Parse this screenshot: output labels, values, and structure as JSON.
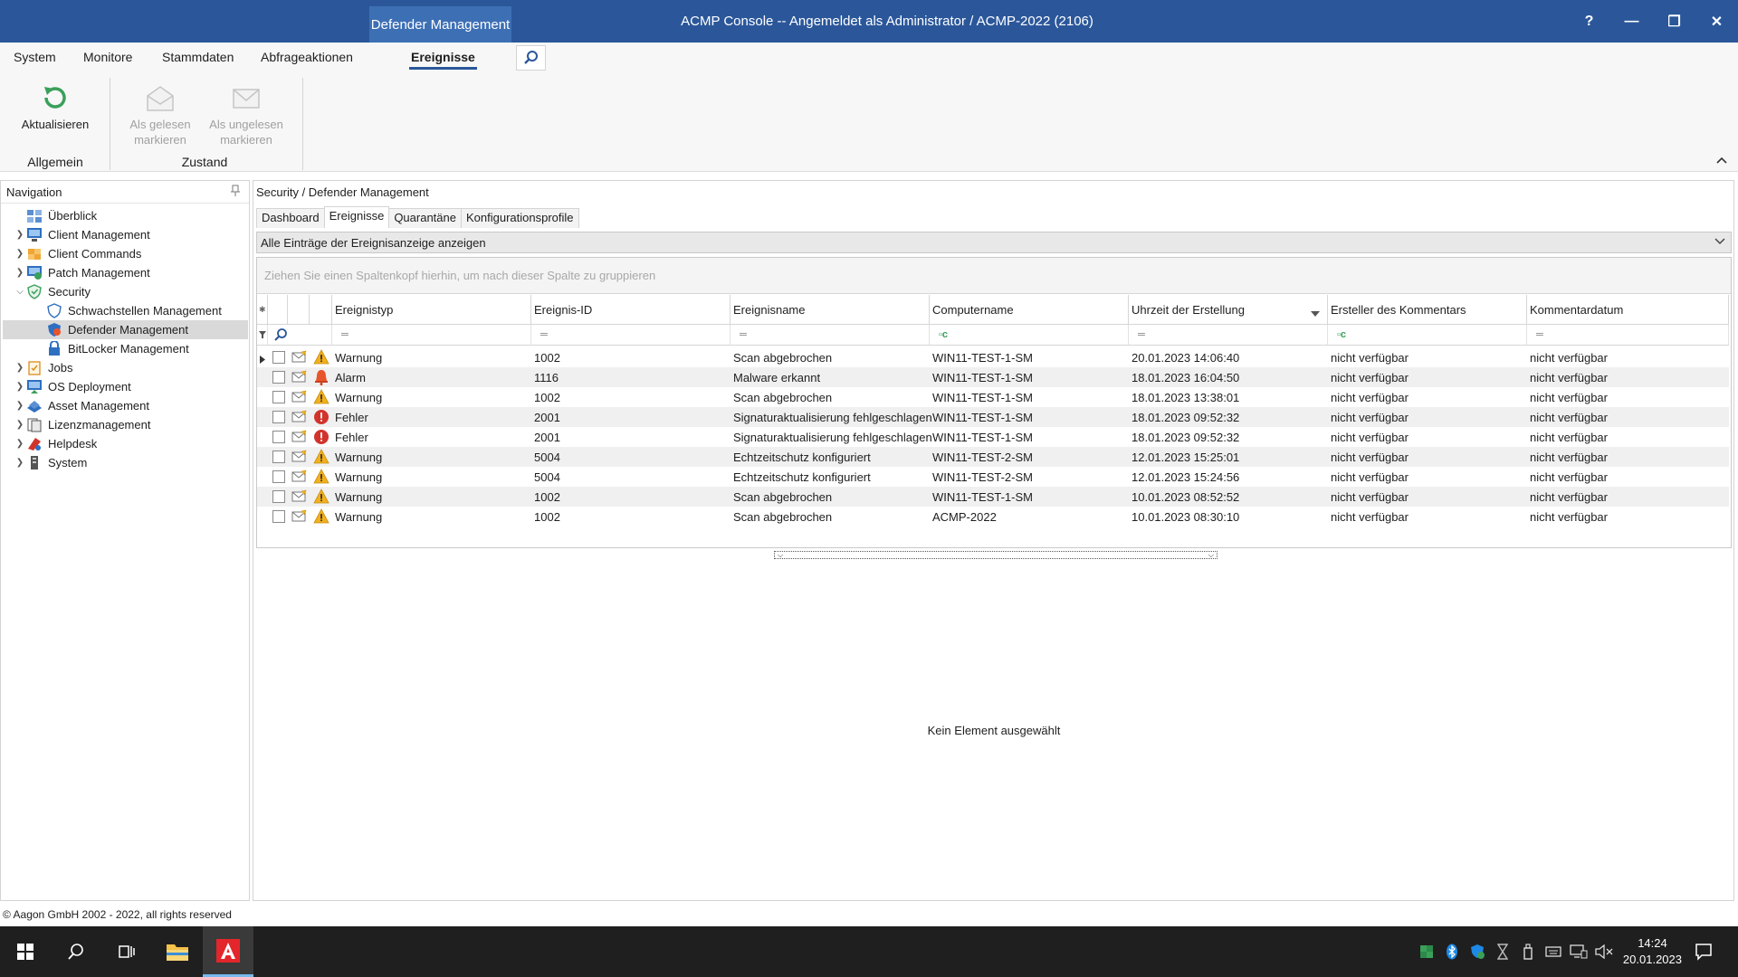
{
  "window": {
    "context_tab": "Defender Management",
    "title": "ACMP Console -- Angemeldet als Administrator / ACMP-2022 (2106)",
    "help": "?",
    "minimize": "—",
    "restore": "❐",
    "close": "✕"
  },
  "ribbon": {
    "tabs": [
      "System",
      "Monitore",
      "Stammdaten",
      "Abfrageaktionen",
      "Ereignisse"
    ],
    "active_tab": "Ereignisse",
    "buttons": {
      "refresh": "Aktualisieren",
      "mark_read_1": "Als gelesen",
      "mark_read_2": "markieren",
      "mark_unread_1": "Als ungelesen",
      "mark_unread_2": "markieren"
    },
    "groups": {
      "general": "Allgemein",
      "state": "Zustand"
    }
  },
  "navigation": {
    "title": "Navigation",
    "items": [
      {
        "label": "Überblick"
      },
      {
        "label": "Client Management"
      },
      {
        "label": "Client Commands"
      },
      {
        "label": "Patch Management"
      },
      {
        "label": "Security"
      },
      {
        "label": "Schwachstellen Management"
      },
      {
        "label": "Defender Management"
      },
      {
        "label": "BitLocker Management"
      },
      {
        "label": "Jobs"
      },
      {
        "label": "OS Deployment"
      },
      {
        "label": "Asset Management"
      },
      {
        "label": "Lizenzmanagement"
      },
      {
        "label": "Helpdesk"
      },
      {
        "label": "System"
      }
    ]
  },
  "main": {
    "breadcrumb": "Security / Defender Management",
    "tabs": [
      "Dashboard",
      "Ereignisse",
      "Quarantäne",
      "Konfigurationsprofile"
    ],
    "filter": "Alle Einträge der Ereignisanzeige anzeigen",
    "group_hint": "Ziehen Sie einen Spaltenkopf hierhin, um nach dieser Spalte zu gruppieren",
    "columns": [
      "Ereignistyp",
      "Ereignis-ID",
      "Ereignisname",
      "Computername",
      "Uhrzeit der Erstellung",
      "Ersteller des Kommentars",
      "Kommentardatum"
    ],
    "rows": [
      {
        "type": "Warnung",
        "icon": "warning",
        "id": "1002",
        "name": "Scan abgebrochen",
        "computer": "WIN11-TEST-1-SM",
        "time": "20.01.2023 14:06:40",
        "author": "nicht verfügbar",
        "cdate": "nicht verfügbar"
      },
      {
        "type": "Alarm",
        "icon": "alarm",
        "id": "1116",
        "name": "Malware erkannt",
        "computer": "WIN11-TEST-1-SM",
        "time": "18.01.2023 16:04:50",
        "author": "nicht verfügbar",
        "cdate": "nicht verfügbar"
      },
      {
        "type": "Warnung",
        "icon": "warning",
        "id": "1002",
        "name": "Scan abgebrochen",
        "computer": "WIN11-TEST-1-SM",
        "time": "18.01.2023 13:38:01",
        "author": "nicht verfügbar",
        "cdate": "nicht verfügbar"
      },
      {
        "type": "Fehler",
        "icon": "error",
        "id": "2001",
        "name": "Signaturaktualisierung fehlgeschlagen",
        "computer": "WIN11-TEST-1-SM",
        "time": "18.01.2023 09:52:32",
        "author": "nicht verfügbar",
        "cdate": "nicht verfügbar"
      },
      {
        "type": "Fehler",
        "icon": "error",
        "id": "2001",
        "name": "Signaturaktualisierung fehlgeschlagen",
        "computer": "WIN11-TEST-1-SM",
        "time": "18.01.2023 09:52:32",
        "author": "nicht verfügbar",
        "cdate": "nicht verfügbar"
      },
      {
        "type": "Warnung",
        "icon": "warning",
        "id": "5004",
        "name": "Echtzeitschutz konfiguriert",
        "computer": "WIN11-TEST-2-SM",
        "time": "12.01.2023 15:25:01",
        "author": "nicht verfügbar",
        "cdate": "nicht verfügbar"
      },
      {
        "type": "Warnung",
        "icon": "warning",
        "id": "5004",
        "name": "Echtzeitschutz konfiguriert",
        "computer": "WIN11-TEST-2-SM",
        "time": "12.01.2023 15:24:56",
        "author": "nicht verfügbar",
        "cdate": "nicht verfügbar"
      },
      {
        "type": "Warnung",
        "icon": "warning",
        "id": "1002",
        "name": "Scan abgebrochen",
        "computer": "WIN11-TEST-1-SM",
        "time": "10.01.2023 08:52:52",
        "author": "nicht verfügbar",
        "cdate": "nicht verfügbar"
      },
      {
        "type": "Warnung",
        "icon": "warning",
        "id": "1002",
        "name": "Scan abgebrochen",
        "computer": "ACMP-2022",
        "time": "10.01.2023 08:30:10",
        "author": "nicht verfügbar",
        "cdate": "nicht verfügbar"
      }
    ],
    "no_selection": "Kein Element ausgewählt"
  },
  "footer": {
    "copyright": "© Aagon GmbH 2002 - 2022, all rights reserved"
  },
  "taskbar": {
    "time": "14:24",
    "date": "20.01.2023"
  },
  "colors": {
    "titlebar": "#2b579a",
    "warning": "#f2b01e",
    "error": "#d1342c",
    "alarm": "#e8542b"
  }
}
